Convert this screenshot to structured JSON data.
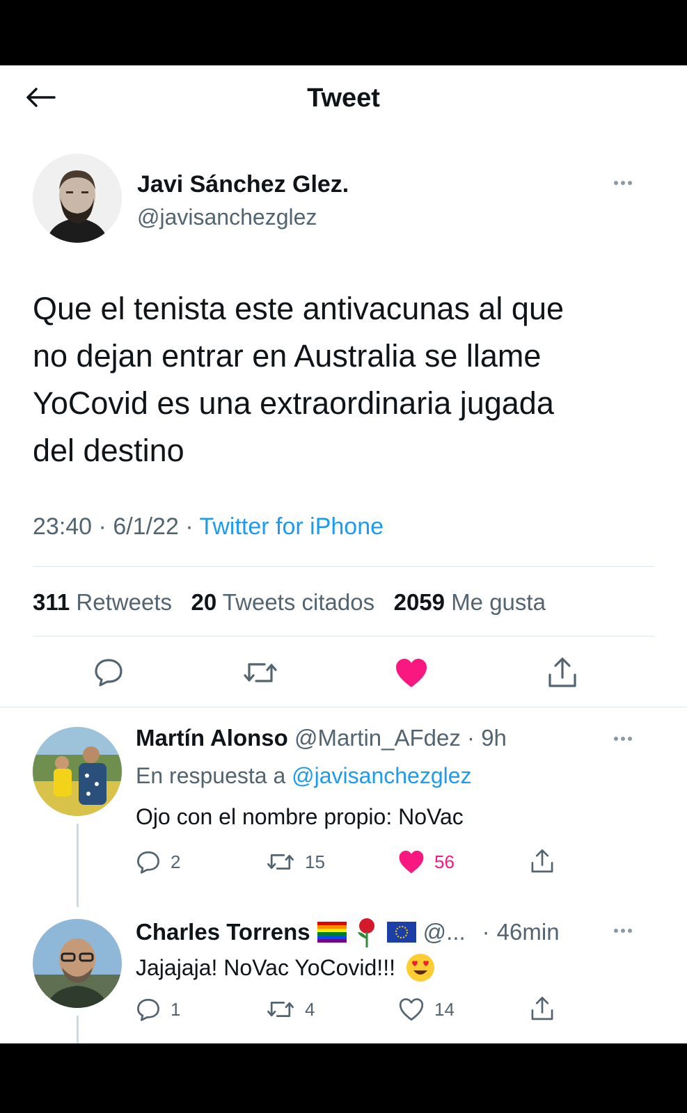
{
  "header": {
    "title": "Tweet"
  },
  "tweet": {
    "author_name": "Javi Sánchez Glez.",
    "author_handle": "@javisanchezglez",
    "text_lines": [
      "Que el tenista este antivacunas al que",
      "no dejan entrar en Australia se llame",
      "YoCovid es una extraordinaria jugada",
      "del destino"
    ],
    "time": "23:40",
    "date": "6/1/22",
    "source": "Twitter for iPhone",
    "stats": {
      "retweets_count": "311",
      "retweets_label": "Retweets",
      "quotes_count": "20",
      "quotes_label": "Tweets citados",
      "likes_count": "2059",
      "likes_label": "Me gusta"
    },
    "liked": true,
    "colors": {
      "like": "#f91880",
      "link": "#1d9bf0",
      "muted": "#536471"
    }
  },
  "replies": [
    {
      "name": "Martín Alonso",
      "handle": "@Martin_AFdez",
      "time": "9h",
      "in_reply_prefix": "En respuesta a",
      "in_reply_handle": "@javisanchezglez",
      "text": "Ojo con el nombre propio: NoVac",
      "replies": "2",
      "retweets": "15",
      "likes": "56",
      "liked": true
    },
    {
      "name": "Charles Torrens",
      "name_emojis": [
        "rainbow-flag-emoji",
        "rose-emoji",
        "eu-flag-emoji"
      ],
      "handle": "@...",
      "time": "46min",
      "text": "Jajajaja! NoVac YoCovid!!!",
      "text_emoji": "heart-eyes-emoji",
      "replies": "1",
      "retweets": "4",
      "likes": "14",
      "liked": false
    }
  ]
}
